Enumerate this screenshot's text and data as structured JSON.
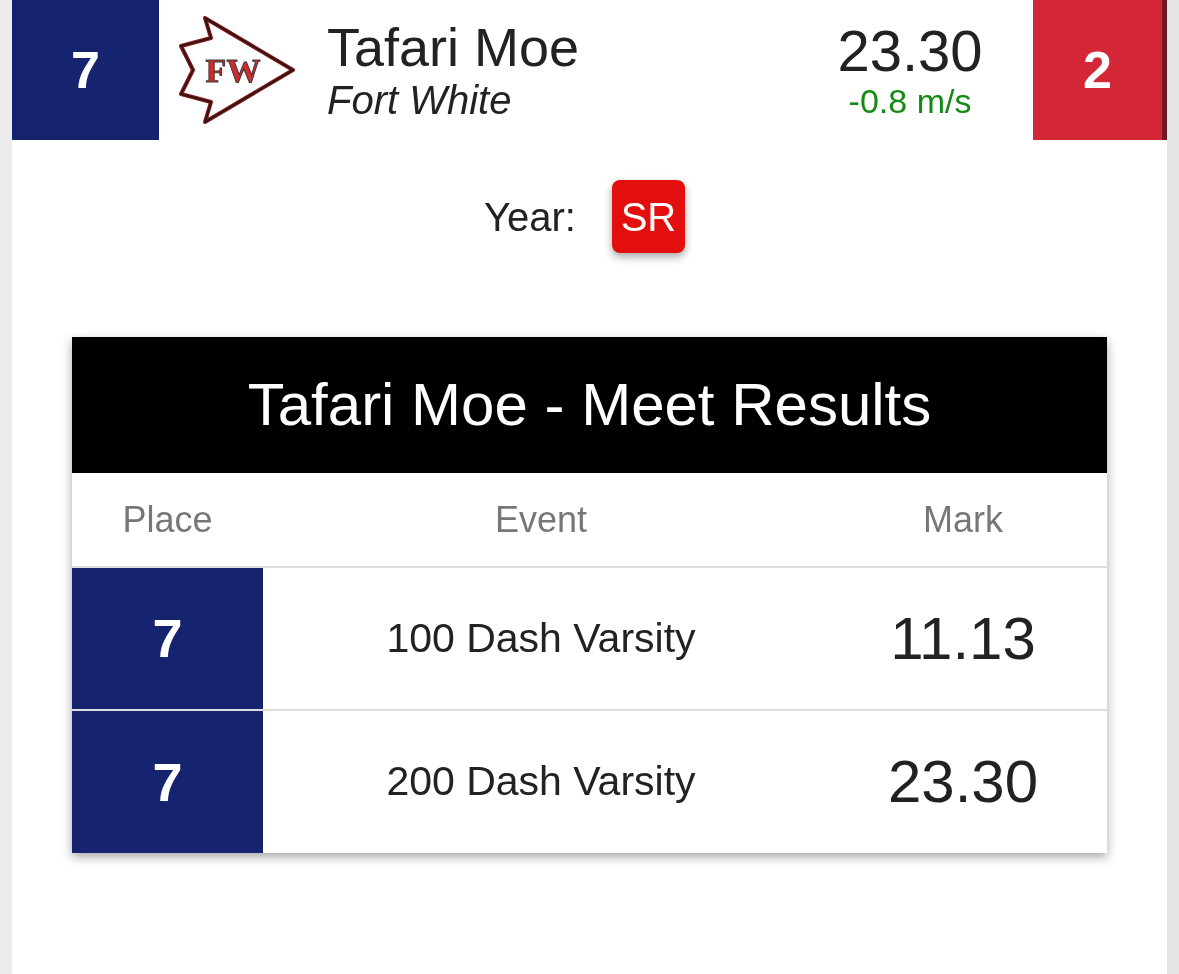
{
  "athlete": {
    "place": "7",
    "logo_text": "FW",
    "name": "Tafari Moe",
    "team": "Fort White",
    "time": "23.30",
    "wind": "-0.8 m/s",
    "side_number": "2"
  },
  "year": {
    "label": "Year:",
    "value": "SR"
  },
  "results": {
    "title": "Tafari Moe - Meet Results",
    "columns": [
      "Place",
      "Event",
      "Mark"
    ],
    "rows": [
      {
        "place": "7",
        "event": "100 Dash Varsity",
        "mark": "11.13"
      },
      {
        "place": "7",
        "event": "200 Dash Varsity",
        "mark": "23.30"
      }
    ]
  }
}
